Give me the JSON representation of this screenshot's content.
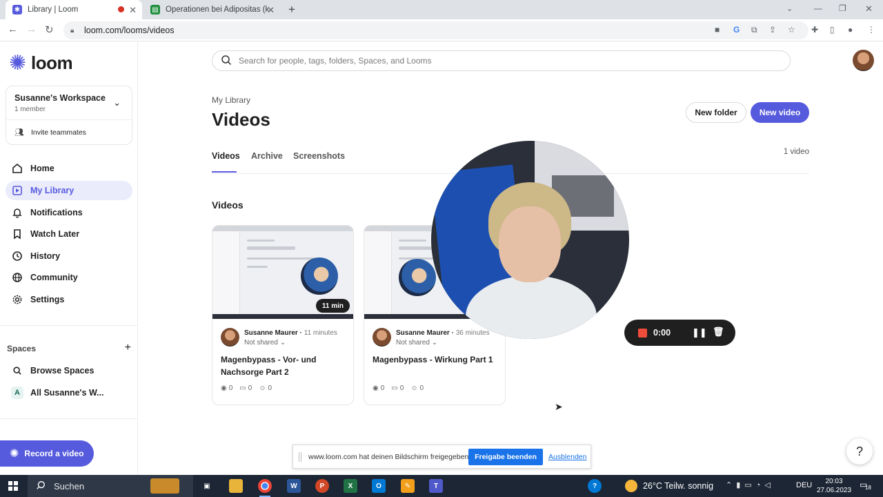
{
  "browser": {
    "tabs": [
      {
        "title": "Library | Loom",
        "active": true
      },
      {
        "title": "Operationen bei Adipositas (kran",
        "active": false
      }
    ],
    "url": "loom.com/looms/videos"
  },
  "sidebar": {
    "logo_text": "loom",
    "workspace": {
      "name": "Susanne's Workspace",
      "members": "1 member",
      "invite_label": "Invite teammates"
    },
    "nav": [
      {
        "label": "Home",
        "icon": "home-icon"
      },
      {
        "label": "My Library",
        "icon": "library-icon",
        "active": true
      },
      {
        "label": "Notifications",
        "icon": "bell-icon"
      },
      {
        "label": "Watch Later",
        "icon": "bookmark-icon"
      },
      {
        "label": "History",
        "icon": "clock-icon"
      },
      {
        "label": "Community",
        "icon": "globe-icon"
      },
      {
        "label": "Settings",
        "icon": "gear-icon"
      }
    ],
    "spaces_label": "Spaces",
    "spaces": [
      {
        "label": "Browse Spaces",
        "icon": "search-icon"
      },
      {
        "label": "All Susanne's W...",
        "icon_letter": "A"
      }
    ],
    "record_label": "Record a video"
  },
  "main": {
    "search_placeholder": "Search for people, tags, folders, Spaces, and Looms",
    "breadcrumb": "My Library",
    "title": "Videos",
    "new_folder_label": "New folder",
    "new_video_label": "New video",
    "tabs": [
      "Videos",
      "Archive",
      "Screenshots"
    ],
    "video_count": "1 video",
    "section_title": "Videos",
    "videos": [
      {
        "author": "Susanne Maurer",
        "time": "11 minutes",
        "shared": "Not shared",
        "title": "Magenbypass - Vor- und Nachsorge Part 2",
        "duration": "11 min",
        "views": "0",
        "comments": "0",
        "reactions": "0"
      },
      {
        "author": "Susanne Maurer",
        "time": "36 minutes",
        "shared": "Not shared",
        "title": "Magenbypass - Wirkung Part 1",
        "views": "0",
        "comments": "0",
        "reactions": "0"
      }
    ]
  },
  "recorder": {
    "timer": "0:00"
  },
  "share_notice": {
    "message": "www.loom.com hat deinen Bildschirm freigegeben.",
    "stop_label": "Freigabe beenden",
    "hide_label": "Ausblenden"
  },
  "help_label": "?",
  "taskbar": {
    "search_label": "Suchen",
    "weather": "26°C  Teilw. sonnig",
    "language": "DEU",
    "time": "20:03",
    "date": "27.06.2023",
    "notification_count": "18"
  },
  "colors": {
    "accent": "#565add",
    "record_red": "#ef4d3b",
    "chrome_blue": "#1a73e8"
  }
}
